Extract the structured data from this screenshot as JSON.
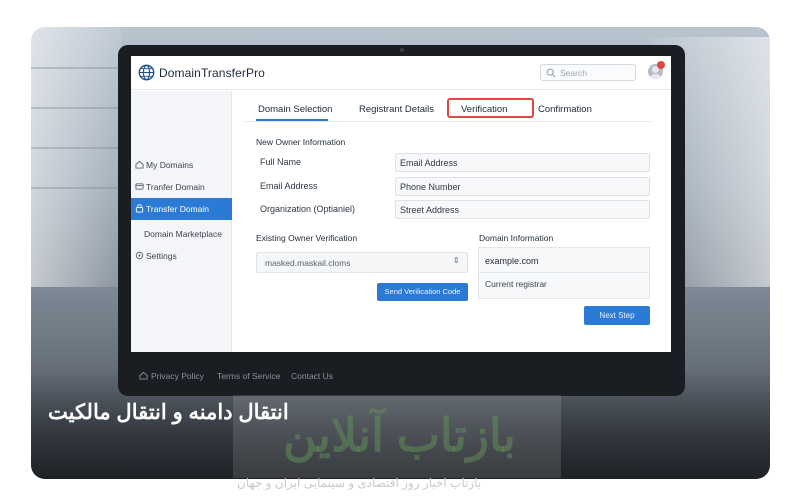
{
  "app": {
    "brand": "DomainTransferPro"
  },
  "header": {
    "search_placeholder": "Search"
  },
  "sidebar": {
    "items": [
      {
        "label": "My Domains",
        "icon": "home-icon"
      },
      {
        "label": "Tranfer Domain",
        "icon": "card-icon"
      },
      {
        "label": "Transfer Domain",
        "icon": "lock-icon",
        "active": true
      },
      {
        "label": "Domain Marketplace",
        "icon": ""
      },
      {
        "label": "Settings",
        "icon": "gear-icon"
      }
    ]
  },
  "tabs": [
    {
      "label": "Domain Selection",
      "active": true
    },
    {
      "label": "Registrant Details"
    },
    {
      "label": "Verification",
      "highlighted": true
    },
    {
      "label": "Confirmation"
    }
  ],
  "new_owner": {
    "title": "New Owner Information",
    "rows": [
      {
        "label": "Full Name",
        "value": "Email Address"
      },
      {
        "label": "Email Address",
        "value": "Phone Number"
      },
      {
        "label": "Organization (Optianiel)",
        "value": "Street Address"
      }
    ]
  },
  "existing_owner": {
    "title": "Existing Owner Verification",
    "select_value": "masked.maskail.cloms",
    "send_button": "Send Verilication Code"
  },
  "domain_info": {
    "title": "Domain Information",
    "domain": "example.com",
    "registrar": "Current registrar"
  },
  "next_button": "Next Step",
  "footer": {
    "links": [
      "Privacy Policy",
      "Terms of Service",
      "Contact Us"
    ]
  },
  "overlay": {
    "headline": "انتقال دامنه و انتقال مالکیت",
    "watermark_big": "بازتاب آنلاین",
    "watermark_small": "بازتاب اخبار روز اقتصادی و سینمایی ایران و جهان"
  },
  "colors": {
    "accent": "#2b7bd6",
    "highlight": "#e0473e",
    "notification": "#e2463c"
  }
}
